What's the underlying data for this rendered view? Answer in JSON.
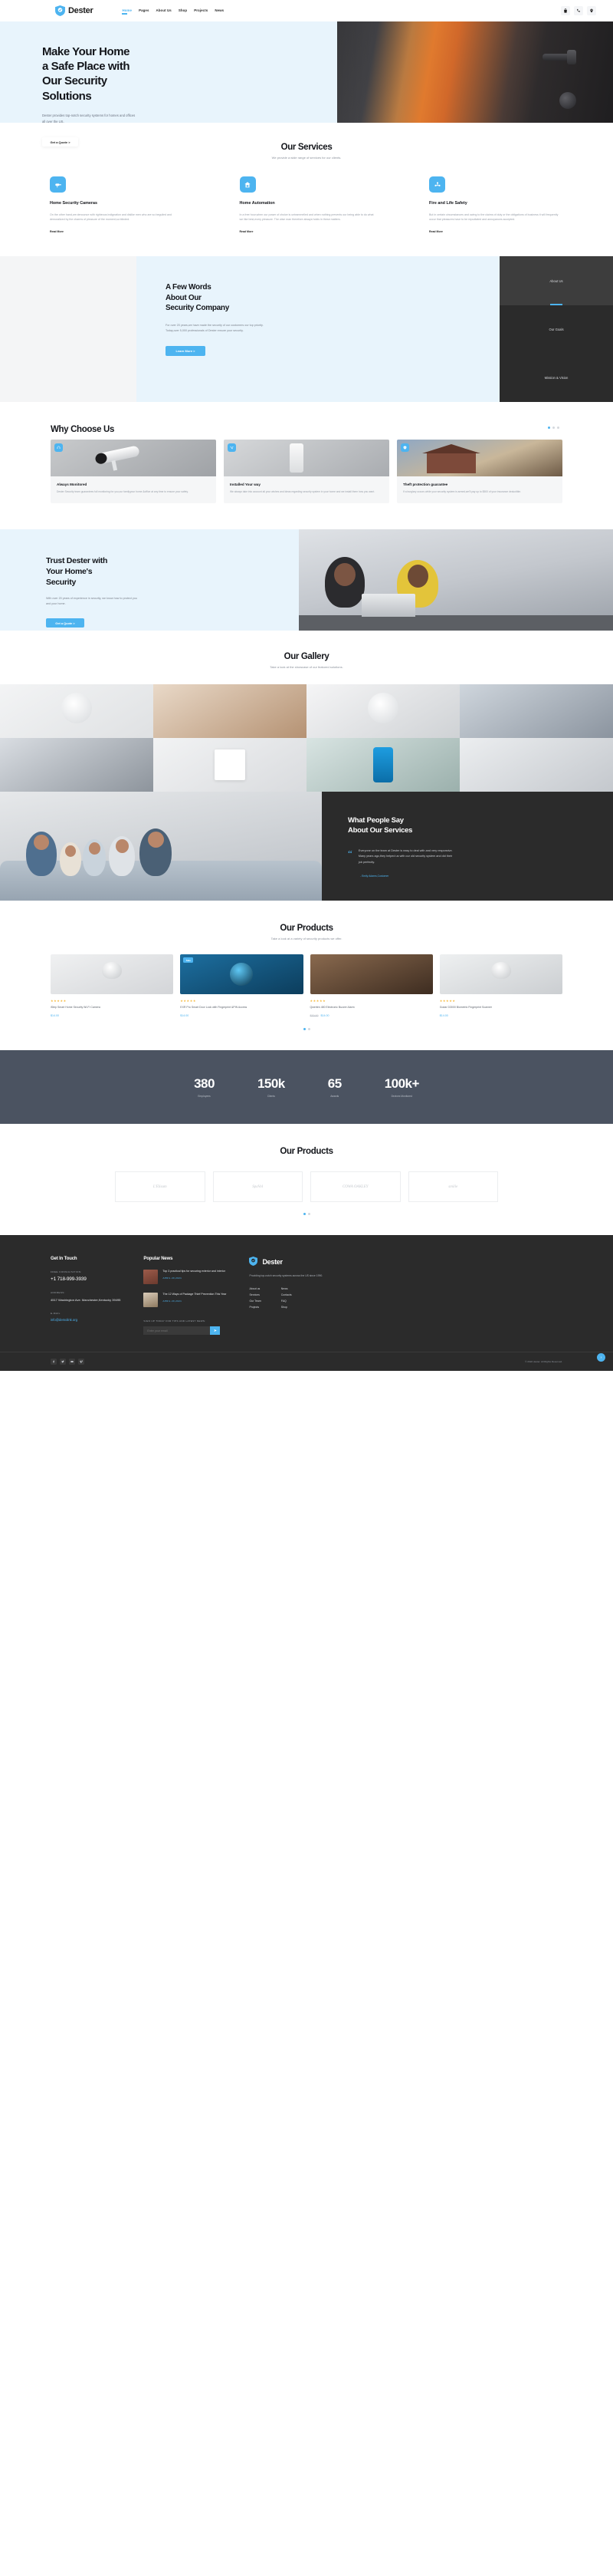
{
  "header": {
    "brand": "Dester",
    "nav": [
      {
        "label": "Home",
        "active": true
      },
      {
        "label": "Pages",
        "active": false
      },
      {
        "label": "About Us",
        "active": false
      },
      {
        "label": "Shop",
        "active": false
      },
      {
        "label": "Projects",
        "active": false
      },
      {
        "label": "News",
        "active": false
      }
    ],
    "icons": [
      "bag-icon",
      "phone-icon",
      "location-icon"
    ]
  },
  "hero": {
    "title_line1": "Make Your Home",
    "title_line2": "a Safe Place with",
    "title_line3": "Our Security",
    "title_line4": "Solutions",
    "subtitle": "Dester provides top-notch security systems for homes and offices all over the US.",
    "cta": "Get a Quote >"
  },
  "services": {
    "title": "Our Services",
    "subtitle": "We provide a wide range of services for our clients.",
    "read_more": "Read More",
    "items": [
      {
        "icon": "camera-icon",
        "title": "Home Security Cameras",
        "text": "On the other hand,we denounce with righteous indignation and dislike men who are so beguiled and demoralized by the charms of pleasure of the moment,so blinded."
      },
      {
        "icon": "home-automation-icon",
        "title": "Home Automation",
        "text": "In a free hour,when our power of choice is untrammelled and when nothing prevents our being able to do what we like best,every pleasure. The wise man therefore always holds in these matters."
      },
      {
        "icon": "fire-safety-icon",
        "title": "Fire and Life Safety",
        "text": "But in certain circumstances and owing to the claims of duty or the obligations of business it will frequently occur that pleasures have to be repudiated and annoyances accepted."
      }
    ]
  },
  "about": {
    "title_line1": "A Few Words",
    "title_line2": "About Our",
    "title_line3": "Security Company",
    "text": "For over 20 years,we have made the security of our customers our top priority. Today,over 5,000 professionals of Dester ensure your security.",
    "cta": "Learn More >",
    "tabs": [
      {
        "label": "About Us",
        "active": true
      },
      {
        "label": "Our Goals",
        "active": false
      },
      {
        "label": "Mission & Vision",
        "active": false
      }
    ]
  },
  "why": {
    "title": "Why Choose Us",
    "cards": [
      {
        "badge": "headset-icon",
        "title": "Always Monitored",
        "text": "Dester Security team guarantees full monitoring for you,our familyyour home &office at any time to ensure your safety."
      },
      {
        "badge": "tools-icon",
        "title": "Installed Your way",
        "text": "We always take into account all your wishes and ideas regarding security system in your home and we install them how you want."
      },
      {
        "badge": "shield-check-icon",
        "title": "Theft protection guarantee",
        "text": "If a burglary occurs while your security system is armed,we'll pay up to $500 of your insurance deductible."
      }
    ]
  },
  "trust": {
    "title_line1": "Trust Dester with",
    "title_line2": "Your Home's",
    "title_line3": "Security",
    "text": "With over 20 years of experience in security, we know how to protect you and your home.",
    "cta": "Get a Quote >"
  },
  "gallery": {
    "title": "Our Gallery",
    "subtitle": "Take a look at the showcase of our featured solutions."
  },
  "testimonial": {
    "title_line1": "What People Say",
    "title_line2": "About Our Services",
    "quote": "Everyone on the team at Dester is easy to deal with and very responsive. Many years ago,they helped us with our old security system and did their job perfectly.",
    "author": "- Emily Adams,Customer"
  },
  "products": {
    "title": "Our Products",
    "subtitle": "Take a look at a variety of security products we offer.",
    "items": [
      {
        "badge": "",
        "name": "iStep Smart Home Security Wi-Fi Camera",
        "price": "$14.00",
        "old_price": "",
        "stars": 5
      },
      {
        "badge": "Sale",
        "name": "EXR Pro Smart Door Lock with Fingerprint &PIN Access",
        "price": "$14.00",
        "old_price": "",
        "stars": 5
      },
      {
        "badge": "",
        "name": "Qwerten 480 Electronic Buzzer Alarm",
        "price": "$14.00",
        "old_price": "$20.00",
        "stars": 5
      },
      {
        "badge": "",
        "name": "Godar D3000 Biometric Fingerprint Scanner",
        "price": "$14.00",
        "old_price": "",
        "stars": 5
      }
    ]
  },
  "stats": [
    {
      "number": "380",
      "label": "Employees"
    },
    {
      "number": "150k",
      "label": "Clients"
    },
    {
      "number": "65",
      "label": "Awards"
    },
    {
      "number": "100k+",
      "label": "Devices Monitored"
    }
  ],
  "brands": {
    "title": "Our Products",
    "items": [
      "L'Elisum",
      "SpaVol",
      "COWA OAKLEY",
      "smilie"
    ]
  },
  "footer": {
    "get_in_touch": {
      "heading": "Get In Touch",
      "consult_label": "FREE CONSULTATION:",
      "phone": "+1 718-999-3939",
      "address_label": "ADDRESS:",
      "address": "4517 Washington Ave. Manchester,Kentucky 39495",
      "email_label": "E-MAIL",
      "email": "info@demolink.org"
    },
    "news": {
      "heading": "Popular News",
      "items": [
        {
          "title": "Top 3 practical tips for securing exterior and interior",
          "date": "APRIL 20,2021"
        },
        {
          "title": "The 12 Ways of Package Thief Prevention This Year",
          "date": "APRIL 20,2021"
        }
      ],
      "signup_label": "SIGN UP TODAY FOR TIPS AND LATEST NEWS:",
      "signup_placeholder": "Enter your email",
      "signup_button": "send-icon"
    },
    "brand": {
      "name": "Dester",
      "desc": "Providing top-notch security systems across the US since 1990.",
      "links_col1": [
        "About us",
        "Services",
        "Our Team",
        "Projects"
      ],
      "links_col2": [
        "News",
        "Contacts",
        "FAQ",
        "Shop"
      ]
    },
    "socials": [
      "facebook-icon",
      "twitter-icon",
      "youtube-icon",
      "vimeo-icon"
    ],
    "copyright": "© 2022 dester. All Rights Reserved."
  }
}
